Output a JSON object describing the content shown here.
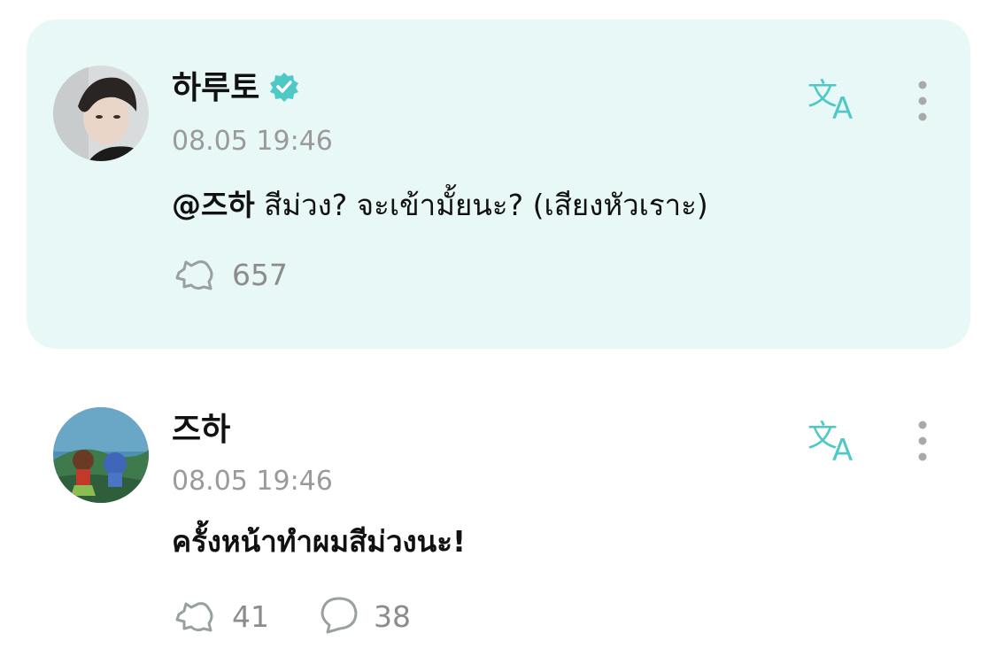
{
  "comments": [
    {
      "author": "하루토",
      "verified": true,
      "time": "08.05 19:46",
      "mention": "@즈하",
      "text": " สีม่วง? จะเข้ามั้ยนะ? (เสียงหัวเราะ)",
      "likes": "657",
      "icons": {
        "avatar": "avatar",
        "verified": "verified-badge-icon",
        "translate": "translate-icon",
        "more": "more-vertical-icon",
        "like": "like-icon"
      },
      "colors": {
        "background": "#e8f8f6",
        "accent": "#4ec9c6"
      }
    },
    {
      "author": "즈하",
      "time": "08.05 19:46",
      "text": "ครั้งหน้าทำผมสีม่วงนะ!",
      "likes": "41",
      "replies": "38",
      "icons": {
        "avatar": "avatar",
        "translate": "translate-icon",
        "more": "more-vertical-icon",
        "like": "like-icon",
        "reply": "reply-bubble-icon"
      }
    }
  ]
}
